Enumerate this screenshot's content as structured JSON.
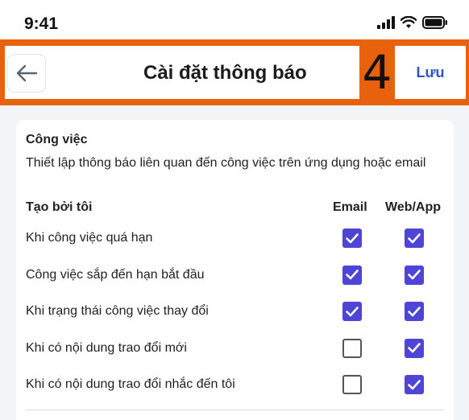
{
  "status_bar": {
    "time": "9:41"
  },
  "header": {
    "title": "Cài đặt thông báo",
    "step_marker": "4",
    "save_label": "Lưu",
    "accent_color": "#e8610c"
  },
  "section": {
    "title": "Công việc",
    "description": "Thiết lập thông báo liên quan đến công việc trên ứng dụng hoặc email"
  },
  "group": {
    "title": "Tạo bởi tôi",
    "columns": {
      "email": "Email",
      "web": "Web/App"
    }
  },
  "rows": [
    {
      "label": "Khi công việc quá hạn",
      "email": true,
      "web": true
    },
    {
      "label": "Công việc sắp đến hạn bắt đầu",
      "email": true,
      "web": true
    },
    {
      "label": "Khi trạng thái công việc thay đổi",
      "email": true,
      "web": true
    },
    {
      "label": "Khi có nội dung trao đổi mới",
      "email": false,
      "web": true
    },
    {
      "label": "Khi có nội dung trao đổi nhắc đến tôi",
      "email": false,
      "web": true
    }
  ],
  "colors": {
    "checkbox_checked": "#4e45d6",
    "save_text": "#2d55c8"
  }
}
